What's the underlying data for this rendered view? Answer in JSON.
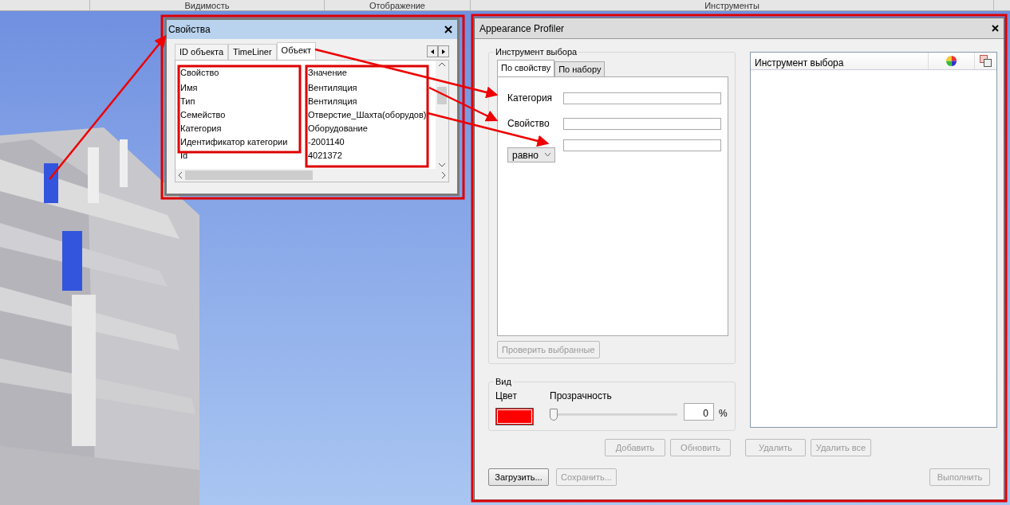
{
  "ribbon_tabs": [
    {
      "label": "Видимость"
    },
    {
      "label": "Отображение"
    },
    {
      "label": "Инструменты"
    }
  ],
  "properties_window": {
    "title": "Свойства",
    "tabs": [
      {
        "label": "ID объекта",
        "selected": false
      },
      {
        "label": "TimeLiner",
        "selected": false
      },
      {
        "label": "Объект",
        "selected": true
      }
    ],
    "columns": [
      "Свойство",
      "Значение"
    ],
    "rows": [
      {
        "property": "Имя",
        "value": "Вентиляция"
      },
      {
        "property": "Тип",
        "value": "Вентиляция"
      },
      {
        "property": "Семейство",
        "value": "Отверстие_Шахта(оборудов)"
      },
      {
        "property": "Категория",
        "value": "Оборудование"
      },
      {
        "property": "Идентификатор категории",
        "value": "-2001140"
      },
      {
        "property": "Id",
        "value": "4021372"
      }
    ]
  },
  "profiler": {
    "title": "Appearance Profiler",
    "selection_group": {
      "legend": "Инструмент выбора",
      "tabs": [
        {
          "label": "По свойству",
          "selected": true
        },
        {
          "label": "По набору",
          "selected": false
        }
      ],
      "fields": [
        {
          "kind": "labeled",
          "label": "Категория"
        },
        {
          "kind": "labeled",
          "label": "Свойство"
        },
        {
          "kind": "operator",
          "operator": "равно"
        }
      ],
      "check_button": {
        "label": "Проверить выбранные",
        "disabled": true
      }
    },
    "view_group": {
      "legend": "Вид",
      "color_label": "Цвет",
      "color": "#ff0000",
      "transparency_label": "Прозрачность",
      "level": 0,
      "value": "0",
      "unit": "%"
    },
    "list": {
      "header": "Инструмент выбора"
    },
    "action_buttons": [
      {
        "label": "Добавить",
        "disabled": true
      },
      {
        "label": "Обновить",
        "disabled": true
      },
      {
        "label": "Удалить",
        "disabled": true
      },
      {
        "label": "Удалить все",
        "disabled": true
      }
    ],
    "footer_buttons": [
      {
        "label": "Загрузить...",
        "disabled": false
      },
      {
        "label": "Сохранить...",
        "disabled": true
      },
      {
        "label": "Выполнить",
        "disabled": true
      }
    ]
  }
}
